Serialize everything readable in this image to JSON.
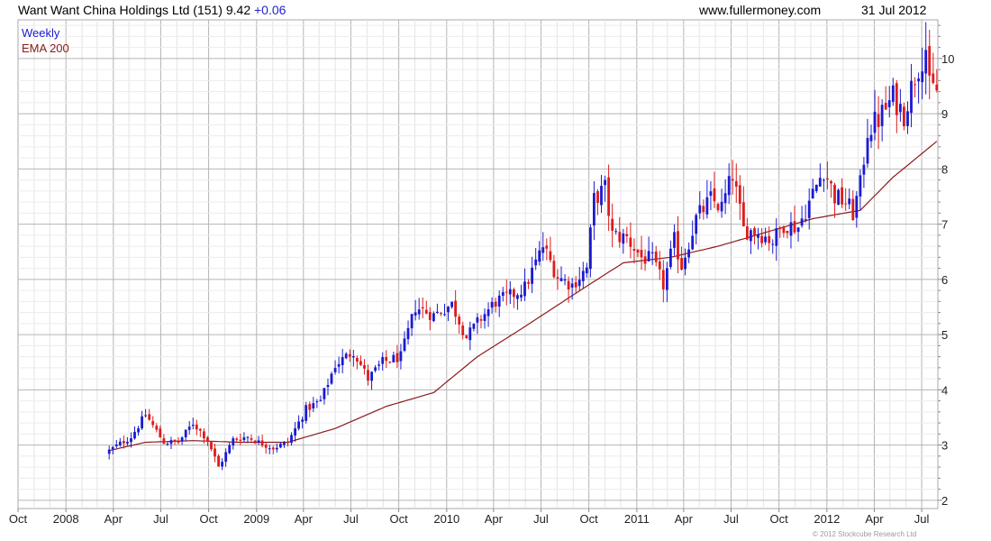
{
  "header": {
    "name": "Want Want China Holdings Ltd",
    "code": "(151)",
    "price": "9.42",
    "change": "+0.06",
    "site": "www.fullermoney.com",
    "date": "31 Jul 2012"
  },
  "legend": {
    "weekly": "Weekly",
    "ema": "EMA 200"
  },
  "copyright": "© 2012 Stockcube Research Ltd",
  "colors": {
    "up": "#1a1ad2",
    "down": "#dd1c1c",
    "ema": "#8b1a1a",
    "grid": "#c8c8c8",
    "background": "#ffffff"
  },
  "chart_data": {
    "type": "candlestick",
    "interval": "weekly",
    "x_axis": {
      "ticks": [
        "Oct",
        "2008",
        "Apr",
        "Jul",
        "Oct",
        "2009",
        "Apr",
        "Jul",
        "Oct",
        "2010",
        "Apr",
        "Jul",
        "Oct",
        "2011",
        "Apr",
        "Jul",
        "Oct",
        "2012",
        "Apr",
        "Jul"
      ],
      "range": [
        "2007-10",
        "2012-08"
      ]
    },
    "y_axis": {
      "ticks": [
        2,
        3,
        4,
        5,
        6,
        7,
        8,
        9,
        10
      ],
      "range": [
        1.85,
        10.7
      ],
      "position": "right"
    },
    "grid": true,
    "legend_position": "top-left",
    "series": [
      {
        "name": "Weekly",
        "kind": "candlestick",
        "anchors": [
          [
            "2008-03-24",
            2.9
          ],
          [
            "2008-05-05",
            3.15
          ],
          [
            "2008-06-02",
            3.55
          ],
          [
            "2008-07-07",
            3.05
          ],
          [
            "2008-08-04",
            3.05
          ],
          [
            "2008-09-01",
            3.4
          ],
          [
            "2008-09-29",
            3.1
          ],
          [
            "2008-10-20",
            2.6
          ],
          [
            "2008-11-17",
            3.1
          ],
          [
            "2008-12-15",
            3.15
          ],
          [
            "2009-01-05",
            3.05
          ],
          [
            "2009-02-02",
            2.95
          ],
          [
            "2009-03-02",
            3.05
          ],
          [
            "2009-04-06",
            3.65
          ],
          [
            "2009-05-04",
            3.8
          ],
          [
            "2009-06-01",
            4.45
          ],
          [
            "2009-07-06",
            4.7
          ],
          [
            "2009-08-03",
            4.2
          ],
          [
            "2009-08-31",
            4.5
          ],
          [
            "2009-10-05",
            4.6
          ],
          [
            "2009-11-02",
            5.5
          ],
          [
            "2009-12-07",
            5.35
          ],
          [
            "2010-01-11",
            5.55
          ],
          [
            "2010-02-08",
            4.95
          ],
          [
            "2010-03-08",
            5.3
          ],
          [
            "2010-04-05",
            5.6
          ],
          [
            "2010-05-03",
            5.7
          ],
          [
            "2010-05-31",
            5.85
          ],
          [
            "2010-07-05",
            6.6
          ],
          [
            "2010-08-02",
            6.05
          ],
          [
            "2010-08-30",
            5.9
          ],
          [
            "2010-09-27",
            6.2
          ],
          [
            "2010-10-11",
            7.45
          ],
          [
            "2010-11-01",
            7.65
          ],
          [
            "2010-11-15",
            6.8
          ],
          [
            "2010-12-13",
            6.75
          ],
          [
            "2011-01-10",
            6.4
          ],
          [
            "2011-01-31",
            6.35
          ],
          [
            "2011-02-21",
            5.9
          ],
          [
            "2011-03-14",
            6.7
          ],
          [
            "2011-03-28",
            6.25
          ],
          [
            "2011-04-25",
            7.1
          ],
          [
            "2011-05-23",
            7.45
          ],
          [
            "2011-06-13",
            7.3
          ],
          [
            "2011-07-04",
            7.9
          ],
          [
            "2011-07-25",
            6.9
          ],
          [
            "2011-08-22",
            6.85
          ],
          [
            "2011-09-19",
            6.7
          ],
          [
            "2011-10-10",
            7.0
          ],
          [
            "2011-11-07",
            6.95
          ],
          [
            "2011-12-05",
            7.55
          ],
          [
            "2011-12-26",
            8.0
          ],
          [
            "2012-01-16",
            7.5
          ],
          [
            "2012-02-06",
            7.4
          ],
          [
            "2012-02-20",
            7.2
          ],
          [
            "2012-03-05",
            7.7
          ],
          [
            "2012-03-19",
            8.7
          ],
          [
            "2012-04-09",
            8.9
          ],
          [
            "2012-05-07",
            9.3
          ],
          [
            "2012-05-28",
            9.0
          ],
          [
            "2012-06-18",
            9.7
          ],
          [
            "2012-07-09",
            10.2
          ],
          [
            "2012-07-16",
            9.45
          ],
          [
            "2012-07-30",
            9.42
          ]
        ]
      },
      {
        "name": "EMA 200",
        "kind": "line",
        "points": [
          [
            "2008-03-24",
            2.9
          ],
          [
            "2008-06-02",
            3.05
          ],
          [
            "2008-09-01",
            3.08
          ],
          [
            "2008-12-01",
            3.05
          ],
          [
            "2009-03-02",
            3.05
          ],
          [
            "2009-06-01",
            3.3
          ],
          [
            "2009-09-07",
            3.7
          ],
          [
            "2009-12-07",
            3.95
          ],
          [
            "2010-03-01",
            4.6
          ],
          [
            "2010-06-01",
            5.15
          ],
          [
            "2010-09-06",
            5.75
          ],
          [
            "2010-12-06",
            6.3
          ],
          [
            "2011-03-07",
            6.4
          ],
          [
            "2011-06-06",
            6.6
          ],
          [
            "2011-09-05",
            6.85
          ],
          [
            "2011-12-05",
            7.1
          ],
          [
            "2012-03-05",
            7.25
          ],
          [
            "2012-05-07",
            7.85
          ],
          [
            "2012-07-30",
            8.5
          ]
        ]
      }
    ]
  }
}
